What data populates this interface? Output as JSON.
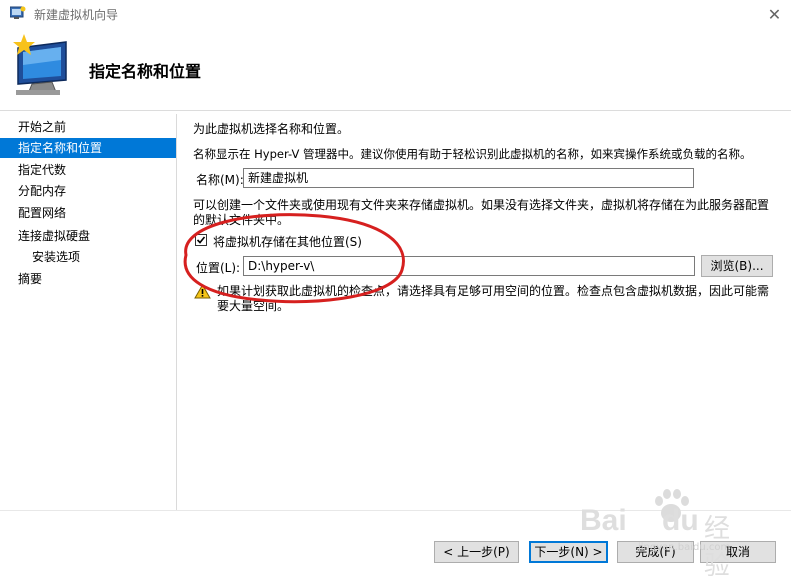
{
  "window": {
    "title": "新建虚拟机向导",
    "close_glyph": "✕",
    "heading": "指定名称和位置"
  },
  "nav": {
    "items": [
      {
        "label": "开始之前"
      },
      {
        "label": "指定名称和位置"
      },
      {
        "label": "指定代数"
      },
      {
        "label": "分配内存"
      },
      {
        "label": "配置网络"
      },
      {
        "label": "连接虚拟硬盘"
      },
      {
        "label": "安装选项"
      },
      {
        "label": "摘要"
      }
    ]
  },
  "main": {
    "intro": "为此虚拟机选择名称和位置。",
    "name_description": "名称显示在 Hyper-V 管理器中。建议你使用有助于轻松识别此虚拟机的名称，如来宾操作系统或负载的名称。",
    "name_label": "名称(M):",
    "name_value": "新建虚拟机",
    "folder_description": "可以创建一个文件夹或使用现有文件夹来存储虚拟机。如果没有选择文件夹，虚拟机将存储在为此服务器配置的默认文件夹中。",
    "store_elsewhere_label": "将虚拟机存储在其他位置(S)",
    "store_elsewhere_checked": true,
    "location_label": "位置(L):",
    "location_value": "D:\\hyper-v\\",
    "browse_label": "浏览(B)...",
    "warning_text": "如果计划获取此虚拟机的检查点，请选择具有足够可用空间的位置。检查点包含虚拟机数据，因此可能需要大量空间。"
  },
  "footer": {
    "prev_label": "< 上一步(P)",
    "next_label": "下一步(N) >",
    "finish_label": "完成(F)",
    "cancel_label": "取消"
  },
  "watermark": {
    "brand": "Bai",
    "brand_suffix": "du",
    "cn": "经验",
    "url": "jingyan.baidu.com"
  },
  "colors": {
    "selection": "#0078d7",
    "annotation": "#d6201f"
  }
}
